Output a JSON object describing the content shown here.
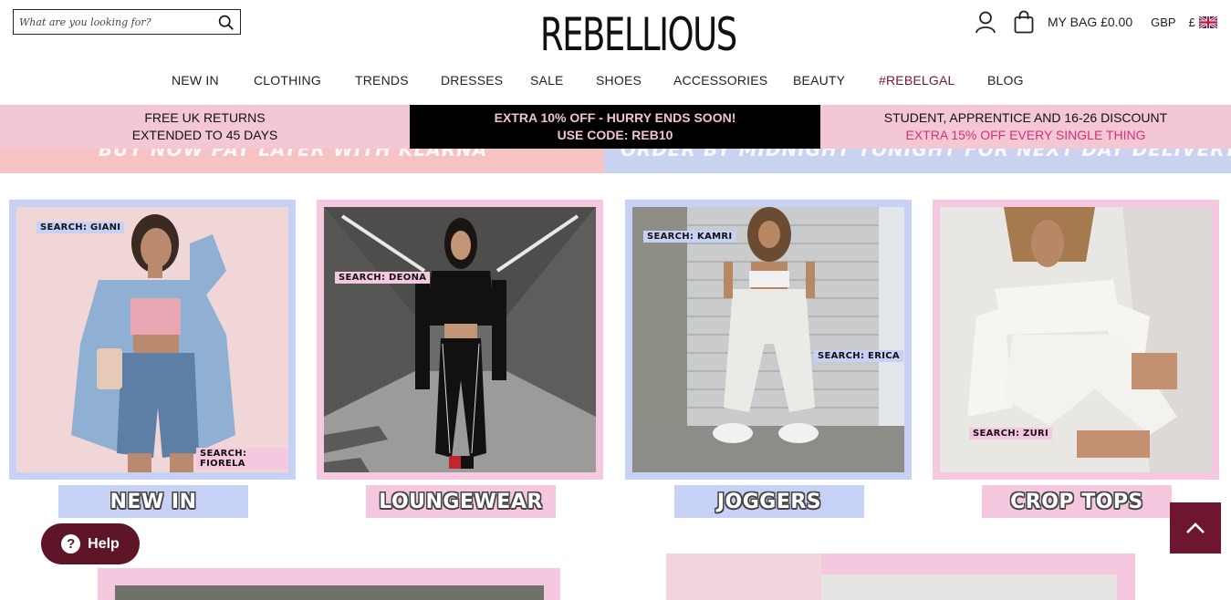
{
  "header": {
    "search_placeholder": "What are you looking for?",
    "logo": "REBELLIOUS",
    "bag_label": "MY BAG £0.00",
    "currency": "GBP",
    "currency_symbol": "£"
  },
  "nav": [
    "NEW IN",
    "CLOTHING",
    "TRENDS",
    "DRESSES",
    "SALE",
    "SHOES",
    "ACCESSORIES",
    "BEAUTY",
    "#REBELGAL",
    "BLOG"
  ],
  "promo": {
    "returns_line1": "FREE UK RETURNS",
    "returns_line2": "EXTENDED TO 45 DAYS",
    "offer_line1": "EXTRA 10% OFF - HURRY ENDS SOON!",
    "offer_line2": "USE CODE: REB10",
    "student_line1": "STUDENT, APPRENTICE AND 16-26 DISCOUNT",
    "student_line2": "EXTRA 15% OFF EVERY SINGLE THING"
  },
  "banner_strip": {
    "left": "BUY NOW PAY LATER WITH KLARNA",
    "right": "ORDER BY MIDNIGHT TONIGHT FOR NEXT DAY DELIVERY"
  },
  "tiles": [
    {
      "button": "NEW IN",
      "tags": [
        "SEARCH: GIANI",
        "SEARCH: FIORELA"
      ]
    },
    {
      "button": "LOUNGEWEAR",
      "tags": [
        "SEARCH: DEONA"
      ]
    },
    {
      "button": "JOGGERS",
      "tags": [
        "SEARCH: KAMRI",
        "SEARCH: ERICA"
      ]
    },
    {
      "button": "CROP TOPS",
      "tags": [
        "SEARCH: ZURI"
      ]
    }
  ],
  "help_label": "Help",
  "colors": {
    "pink": "#f3c7d4",
    "blue": "#c7d1f5",
    "burgundy": "#6e1530",
    "accent_pink": "#d3327a"
  }
}
